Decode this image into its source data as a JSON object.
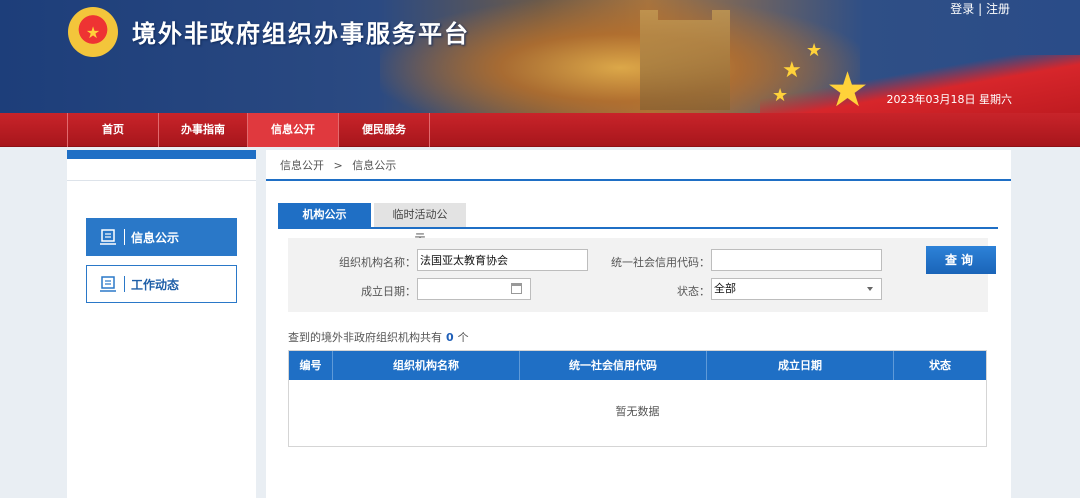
{
  "header": {
    "site_title": "境外非政府组织办事服务平台",
    "login": "登录",
    "divider": "|",
    "register": "注册",
    "date": "2023年03月18日 星期六"
  },
  "nav": {
    "items": [
      {
        "label": "首页"
      },
      {
        "label": "办事指南"
      },
      {
        "label": "信息公开"
      },
      {
        "label": "便民服务"
      }
    ],
    "active_index": 2
  },
  "sidebar": {
    "items": [
      {
        "label": "信息公示",
        "icon": "document-icon"
      },
      {
        "label": "工作动态",
        "icon": "document-icon"
      }
    ]
  },
  "breadcrumb": {
    "root": "信息公开",
    "sep": ">",
    "current": "信息公示"
  },
  "tabs": [
    {
      "label": "机构公示"
    },
    {
      "label": "临时活动公示"
    }
  ],
  "search": {
    "org_name_label": "组织机构名称：",
    "org_name_value": "法国亚太教育协会",
    "credit_code_label": "统一社会信用代码：",
    "credit_code_value": "",
    "date_label": "成立日期：",
    "date_value": "",
    "status_label": "状态：",
    "status_value": "全部",
    "query_button": "查询"
  },
  "result": {
    "prefix": "查到的境外非政府组织机构共有",
    "count": "0",
    "suffix": "个"
  },
  "table": {
    "columns": [
      "编号",
      "组织机构名称",
      "统一社会信用代码",
      "成立日期",
      "状态"
    ],
    "rows": [],
    "empty_text": "暂无数据"
  },
  "colors": {
    "header_blue": "#1d3e7a",
    "nav_red": "#c8242a",
    "accent_blue": "#1f6fc5"
  }
}
